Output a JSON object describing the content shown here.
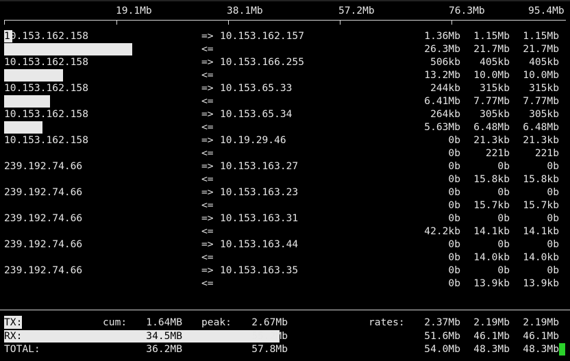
{
  "scale": {
    "labels": [
      "19.1Mb",
      "38.1Mb",
      "57.2Mb",
      "76.3Mb",
      "95.4Mb"
    ]
  },
  "flows": [
    {
      "src": "10.153.162.158",
      "dst": "10.153.162.157",
      "send": [
        "1.36Mb",
        "1.15Mb",
        "1.15Mb"
      ],
      "recv": [
        "26.3Mb",
        "21.7Mb",
        "21.7Mb"
      ],
      "send_fraction": 0.0143,
      "recv_fraction": 0.2277
    },
    {
      "src": "10.153.162.158",
      "dst": "10.153.166.255",
      "send": [
        "506kb",
        "405kb",
        "405kb"
      ],
      "recv": [
        "13.2Mb",
        "10.0Mb",
        "10.0Mb"
      ],
      "send_fraction": 0.0,
      "recv_fraction": 0.1048
    },
    {
      "src": "10.153.162.158",
      "dst": "10.153.65.33",
      "send": [
        "244kb",
        "315kb",
        "315kb"
      ],
      "recv": [
        "6.41Mb",
        "7.77Mb",
        "7.77Mb"
      ],
      "send_fraction": 0.0,
      "recv_fraction": 0.0814
    },
    {
      "src": "10.153.162.158",
      "dst": "10.153.65.34",
      "send": [
        "264kb",
        "305kb",
        "305kb"
      ],
      "recv": [
        "5.63Mb",
        "6.48Mb",
        "6.48Mb"
      ],
      "send_fraction": 0.0,
      "recv_fraction": 0.0679
    },
    {
      "src": "10.153.162.158",
      "dst": "10.19.29.46",
      "send": [
        "0b",
        "21.3kb",
        "21.3kb"
      ],
      "recv": [
        "0b",
        "221b",
        "221b"
      ],
      "send_fraction": 0.0,
      "recv_fraction": 0.0
    },
    {
      "src": "239.192.74.66",
      "dst": "10.153.163.27",
      "send": [
        "0b",
        "0b",
        "0b"
      ],
      "recv": [
        "0b",
        "15.8kb",
        "15.8kb"
      ],
      "send_fraction": 0.0,
      "recv_fraction": 0.0
    },
    {
      "src": "239.192.74.66",
      "dst": "10.153.163.23",
      "send": [
        "0b",
        "0b",
        "0b"
      ],
      "recv": [
        "0b",
        "15.7kb",
        "15.7kb"
      ],
      "send_fraction": 0.0,
      "recv_fraction": 0.0
    },
    {
      "src": "239.192.74.66",
      "dst": "10.153.163.31",
      "send": [
        "0b",
        "0b",
        "0b"
      ],
      "recv": [
        "42.2kb",
        "14.1kb",
        "14.1kb"
      ],
      "send_fraction": 0.0,
      "recv_fraction": 0.0
    },
    {
      "src": "239.192.74.66",
      "dst": "10.153.163.44",
      "send": [
        "0b",
        "0b",
        "0b"
      ],
      "recv": [
        "0b",
        "14.0kb",
        "14.0kb"
      ],
      "send_fraction": 0.0,
      "recv_fraction": 0.0
    },
    {
      "src": "239.192.74.66",
      "dst": "10.153.163.35",
      "send": [
        "0b",
        "0b",
        "0b"
      ],
      "recv": [
        "0b",
        "13.9kb",
        "13.9kb"
      ],
      "send_fraction": 0.0,
      "recv_fraction": 0.0
    }
  ],
  "arrows": {
    "send": "=>",
    "recv": "<="
  },
  "totals": {
    "tx": {
      "label": "TX:",
      "cum_label": "cum:",
      "cum": "1.64MB",
      "peak_label": "peak:",
      "peak": "2.67Mb",
      "rates_label": "rates:",
      "rates": [
        "2.37Mb",
        "2.19Mb",
        "2.19Mb"
      ]
    },
    "rx": {
      "label": "RX:",
      "cum": "34.5MB",
      "peak": "55.2Mb",
      "rates": [
        "51.6Mb",
        "46.1Mb",
        "46.1Mb"
      ],
      "bar_fraction": 0.4906
    },
    "total": {
      "label": "TOTAL:",
      "cum": "36.2MB",
      "peak": "57.8Mb",
      "rates": [
        "54.0Mb",
        "48.3Mb",
        "48.3Mb"
      ]
    }
  }
}
